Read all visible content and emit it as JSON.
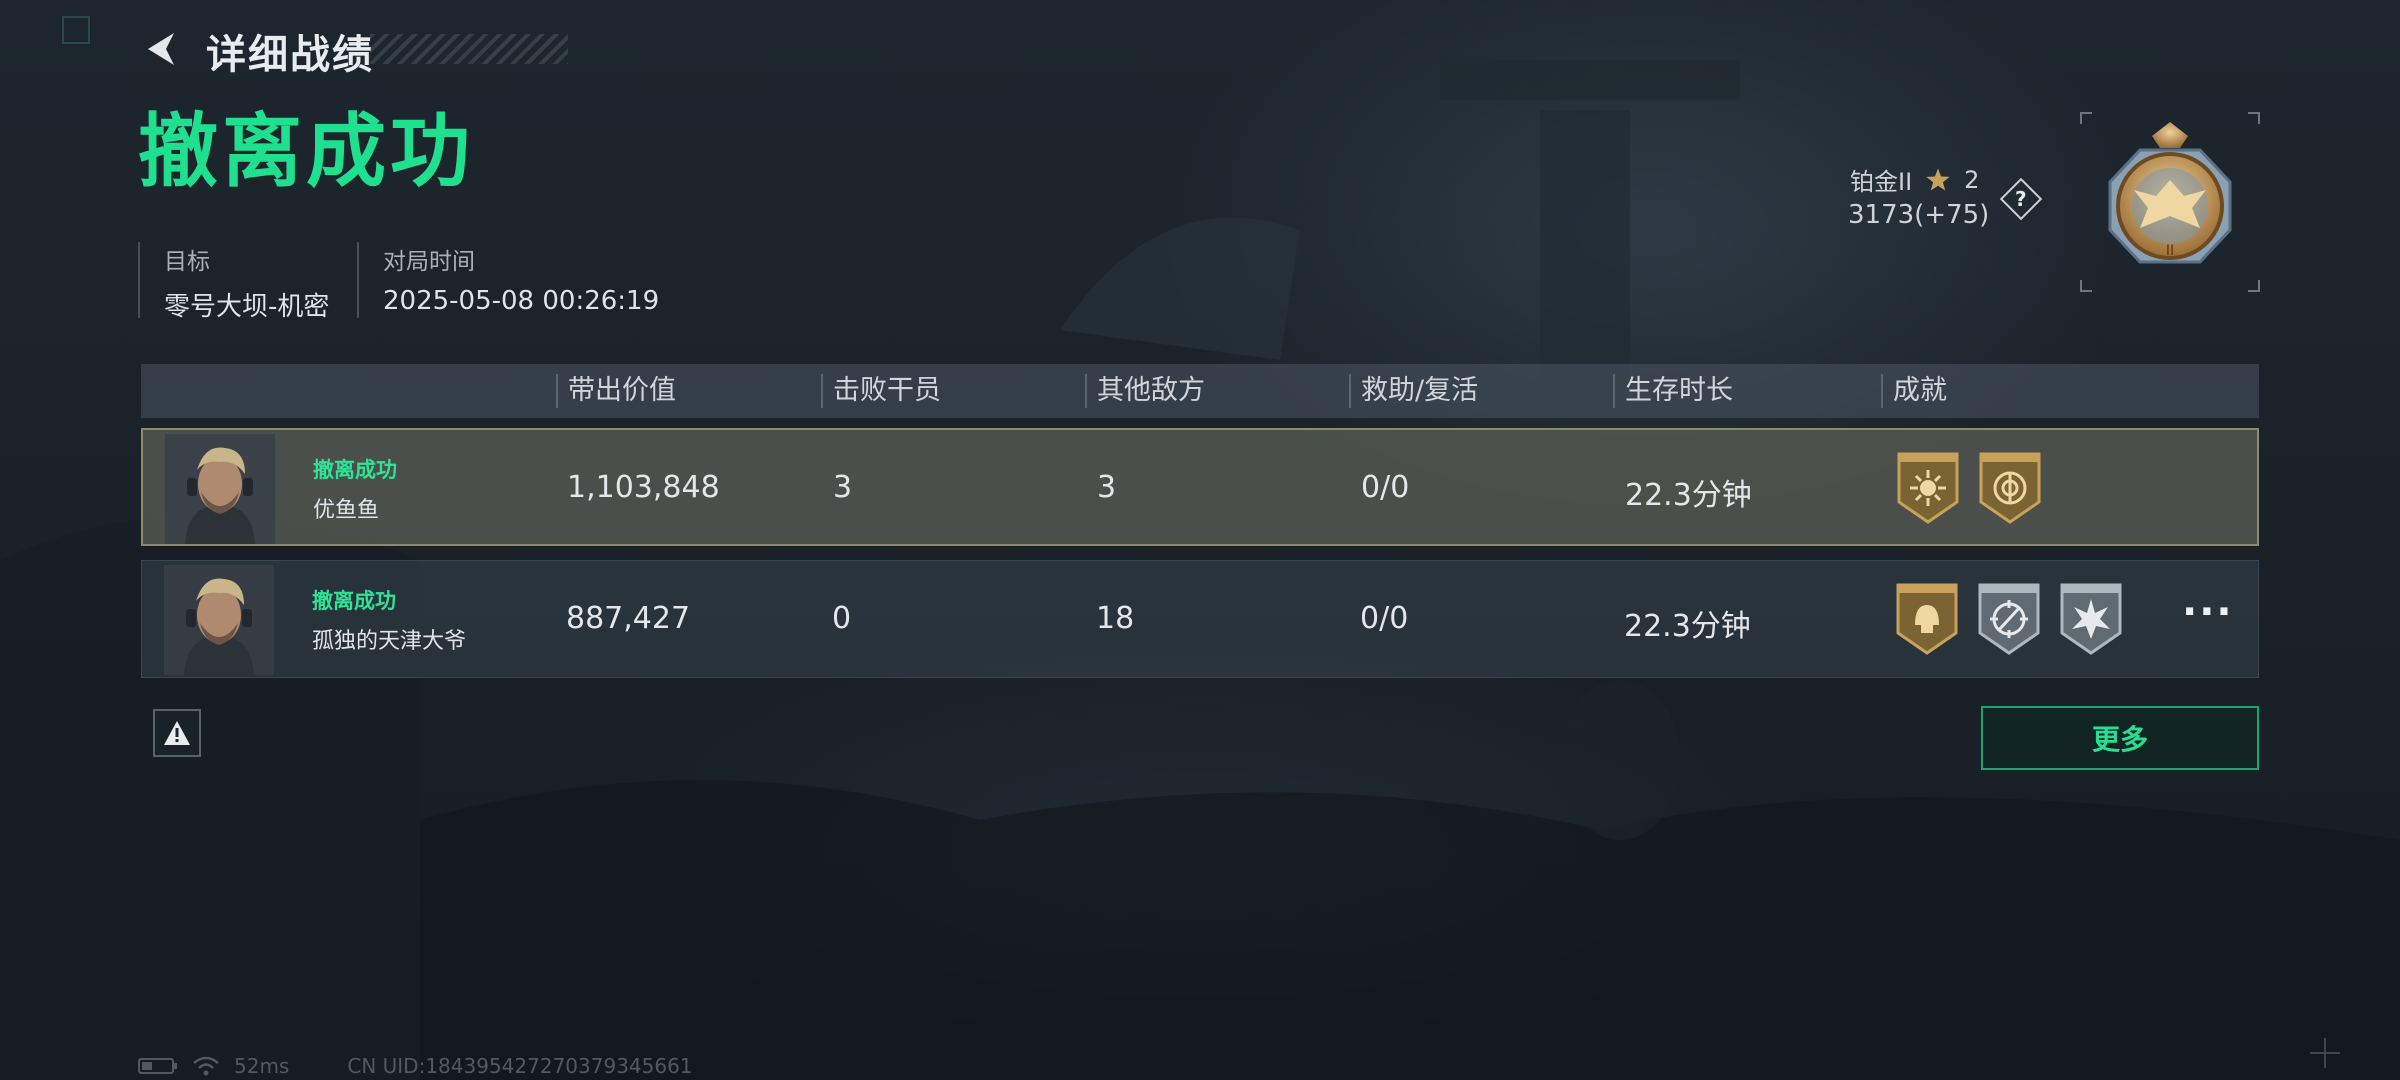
{
  "header": {
    "title": "详细战绩"
  },
  "result": {
    "title": "撤离成功"
  },
  "info": {
    "target_label": "目标",
    "target_value": "零号大坝-机密",
    "time_label": "对局时间",
    "time_value": "2025-05-08 00:26:19"
  },
  "rank": {
    "name": "铂金II",
    "stars": "2",
    "score": "3173(+75)",
    "help": "?"
  },
  "table": {
    "headers": [
      "带出价值",
      "击败干员",
      "其他敌方",
      "救助/复活",
      "生存时长",
      "成就"
    ],
    "rows": [
      {
        "status": "撤离成功",
        "name": "优鱼鱼",
        "value": "1,103,848",
        "kills": "3",
        "others": "3",
        "assists": "0/0",
        "survival": "22.3分钟",
        "achievements": [
          "sun-achievement-icon",
          "circle-achievement-icon"
        ]
      },
      {
        "status": "撤离成功",
        "name": "孤独的天津大爷",
        "value": "887,427",
        "kills": "0",
        "others": "18",
        "assists": "0/0",
        "survival": "22.3分钟",
        "achievements": [
          "helmet-achievement-icon",
          "crosshair-achievement-icon",
          "burst-achievement-icon"
        ],
        "more": "···"
      }
    ]
  },
  "buttons": {
    "more": "更多"
  },
  "status_bar": {
    "ping": "52ms",
    "uid": "CN UID:184395427270379345661"
  },
  "colors": {
    "accent_green": "#1ee08f",
    "gold": "#c9a15a",
    "highlight_row_border": "#8e8a6a"
  }
}
